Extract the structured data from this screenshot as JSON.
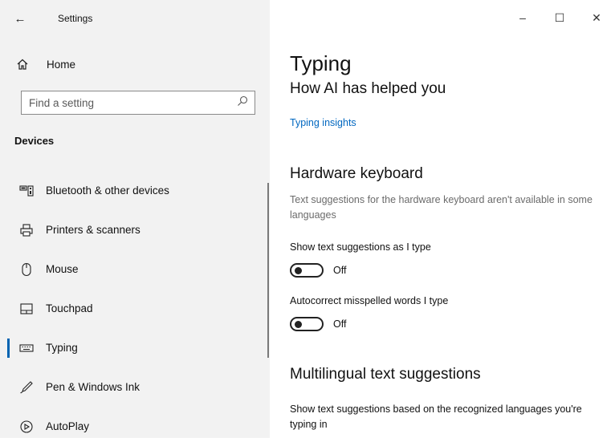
{
  "window": {
    "title": "Settings",
    "controls": {
      "minimize": "–",
      "maximize": "☐",
      "close": "✕"
    }
  },
  "sidebar": {
    "home_label": "Home",
    "search": {
      "placeholder": "Find a setting"
    },
    "section_header": "Devices",
    "items": [
      {
        "label": "Bluetooth & other devices",
        "icon": "bluetooth-devices-icon",
        "selected": false
      },
      {
        "label": "Printers & scanners",
        "icon": "printer-icon",
        "selected": false
      },
      {
        "label": "Mouse",
        "icon": "mouse-icon",
        "selected": false
      },
      {
        "label": "Touchpad",
        "icon": "touchpad-icon",
        "selected": false
      },
      {
        "label": "Typing",
        "icon": "keyboard-icon",
        "selected": true
      },
      {
        "label": "Pen & Windows Ink",
        "icon": "pen-icon",
        "selected": false
      },
      {
        "label": "AutoPlay",
        "icon": "autoplay-icon",
        "selected": false
      }
    ]
  },
  "main": {
    "page_title": "Typing",
    "ai_section": {
      "title": "How AI has helped you",
      "link": "Typing insights"
    },
    "hardware_keyboard": {
      "title": "Hardware keyboard",
      "description": "Text suggestions for the hardware keyboard aren't available in some languages",
      "settings": [
        {
          "label": "Show text suggestions as I type",
          "state": "Off",
          "on": false
        },
        {
          "label": "Autocorrect misspelled words I type",
          "state": "Off",
          "on": false
        }
      ]
    },
    "multilingual": {
      "title": "Multilingual text suggestions",
      "description": "Show text suggestions based on the recognized languages you're typing in"
    }
  },
  "colors": {
    "sidebar_bg": "#f2f2f2",
    "accent": "#0063b1",
    "link": "#0067c0"
  }
}
